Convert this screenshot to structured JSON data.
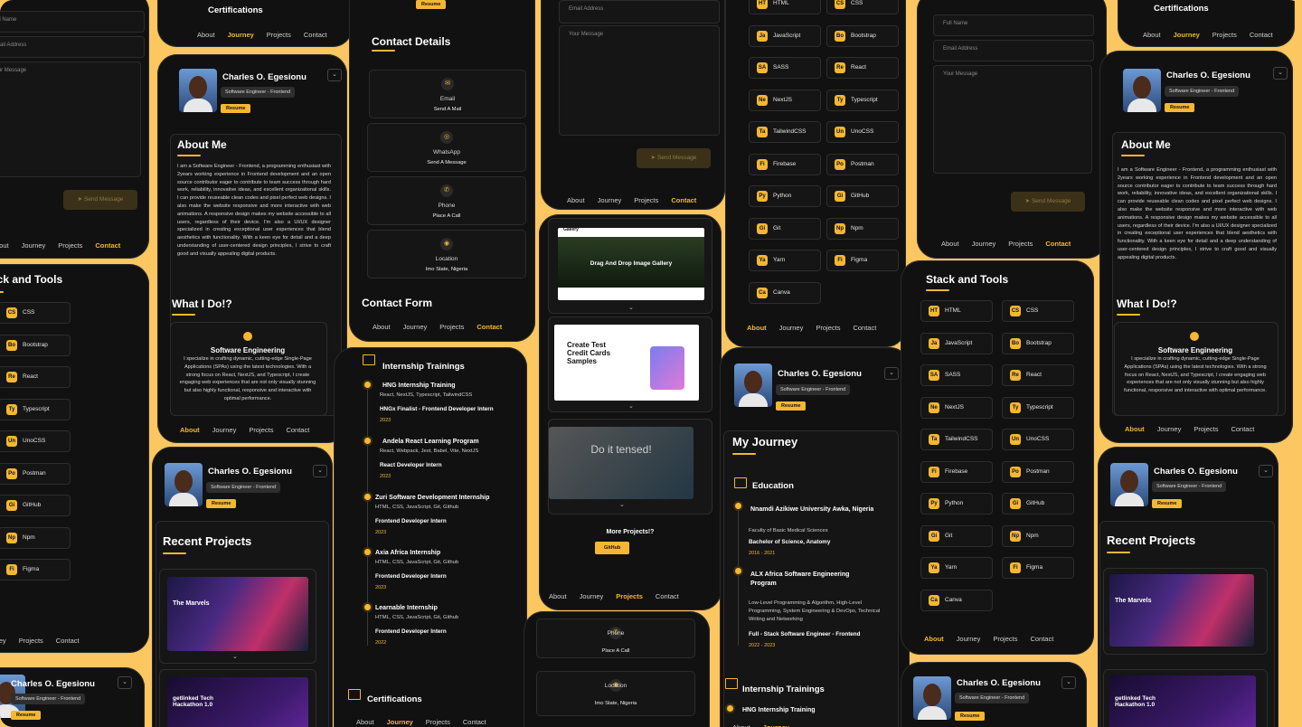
{
  "nav": {
    "about": "About",
    "journey": "Journey",
    "projects": "Projects",
    "contact": "Contact"
  },
  "profile": {
    "name": "Charles O. Egesionu",
    "role": "Software Engineer - Frontend",
    "resume": "Resume"
  },
  "about": {
    "title": "About Me",
    "text": "I am a Software Engineer - Frontend, a programming enthusiast with 2years working experience in Frontend development and an open source contributor eager to contribute to team success through hard work, reliability, innovative ideas, and excellent organizational skills. I can provide reuseable clean codes and pixel perfect web designs. I also make the website responsive and more interactive with web animations. A responsive design makes my website accessible to all users, regardless of their device. I'm also a UI/UX designer specialized in creating exceptional user experiences that blend aesthetics with functionality. With a keen eye for detail and a deep understanding of user-centered design principles, I strive to craft good and visually appealing digital products."
  },
  "what_i_do": {
    "title": "What I Do!?",
    "service_title": "Software Engineering",
    "service_text": "I specialize in crafting dynamic, cutting-edge Single-Page Applications (SPAs) using the latest technologies. With a strong focus on React, NextJS, and Typescript, I create engaging web experiences that are not only visually stunning but also highly functional, responsive and interactive with optimal performance."
  },
  "contact_form": {
    "title": "Contact Form",
    "full_name": "Full Name",
    "email": "Email Address",
    "message": "Your Message",
    "send": "Send Message"
  },
  "contact_details": {
    "title": "Contact Details",
    "items": [
      {
        "label": "Email",
        "action": "Send A Mail",
        "icon": "mail-icon"
      },
      {
        "label": "WhatsApp",
        "action": "Send A Message",
        "icon": "whatsapp-icon"
      },
      {
        "label": "Phone",
        "action": "Place A Call",
        "icon": "phone-icon"
      },
      {
        "label": "Location",
        "action": "Imo State, Nigeria",
        "icon": "location-icon"
      }
    ]
  },
  "stack": {
    "title": "Stack and Tools",
    "items": [
      "HTML",
      "CSS",
      "JavaScript",
      "Bootstrap",
      "SASS",
      "React",
      "NextJS",
      "Typescript",
      "TailwindCSS",
      "UnoCSS",
      "Firebase",
      "Postman",
      "Python",
      "GitHub",
      "Git",
      "Npm",
      "Yarn",
      "Figma",
      "Canva"
    ]
  },
  "projects": {
    "title": "Recent Projects",
    "more": "More Projects!?",
    "github": "GitHub",
    "gallery": "Drag And Drop Image Gallery",
    "gallery_label": "Gallery",
    "credit": "Create Test Credit Cards Samples",
    "game": "Do it tensed!",
    "marvels": "The Marvels",
    "getlinked": "getlinked Tech Hackathon 1.0"
  },
  "journey": {
    "title": "My Journey",
    "education_title": "Education",
    "education": [
      {
        "school": "Nnamdi Azikiwe University Awka, Nigeria",
        "faculty": "Faculty of Basic Medical Sciences",
        "degree": "Bachelor of Science, Anatomy",
        "years": "2016 - 2021"
      },
      {
        "school": "ALX Africa Software Engineering Program",
        "faculty": "Low-Level Programming & Algorithm, High-Level Programming, System Engineering & DevOps, Technical Writing and Networking",
        "degree": "Full - Stack Software Engineer - Frontend",
        "years": "2022 - 2023"
      }
    ],
    "internship_title": "Internship Trainings",
    "internships": [
      {
        "name": "HNG Internship Training",
        "stack": "React, NextJS, Typescript, TailwindCSS",
        "role": "HNGx Finalist - Frontend Developer Intern",
        "year": "2023"
      },
      {
        "name": "Andela React Learning Program",
        "stack": "React, Webpack, Jest, Babel, Vite, NextJS",
        "role": "React Developer Intern",
        "year": "2023"
      },
      {
        "name": "Zuri Software Development Internship",
        "stack": "HTML, CSS, JavaScript, Git, Github",
        "role": "Frontend Developer Intern",
        "year": "2023"
      },
      {
        "name": "Axia Africa Internship",
        "stack": "HTML, CSS, JavaScript, Git, Github",
        "role": "Frontend Developer Intern",
        "year": "2023"
      },
      {
        "name": "Learnable Internship",
        "stack": "HTML, CSS, JavaScript, Git, Github",
        "role": "Frontend Developer Intern",
        "year": "2022"
      }
    ],
    "certifications_title": "Certifications"
  },
  "colors": {
    "accent": "#f5b731",
    "background": "#fcc660",
    "panel": "#111112"
  }
}
